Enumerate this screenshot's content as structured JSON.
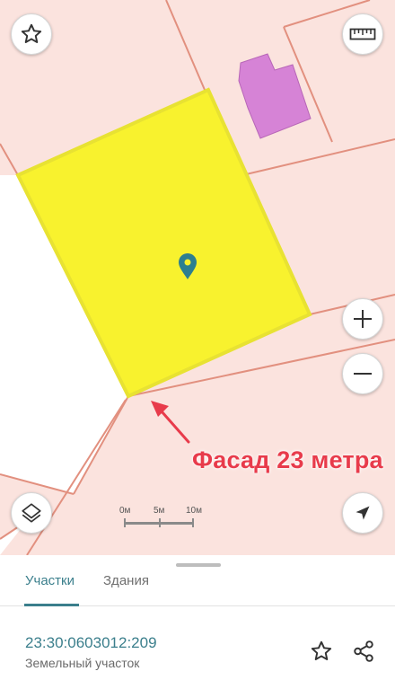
{
  "map": {
    "annotation": "Фасад 23 метра",
    "scale_labels": [
      "0м",
      "5м",
      "10м"
    ],
    "colors": {
      "land": "#fbe3de",
      "parcel_border": "#e2907f",
      "selected_fill": "#f8f22e",
      "selected_border": "#e8e232",
      "building": "#d683d6",
      "annotation": "#e83b4b",
      "marker": "#2d7f8f"
    },
    "controls": {
      "favorite": "star-icon",
      "ruler": "ruler-icon",
      "zoom_in": "plus-icon",
      "zoom_out": "minus-icon",
      "layers": "layers-icon",
      "locate": "navigation-arrow-icon"
    }
  },
  "panel": {
    "tabs": [
      {
        "label": "Участки",
        "active": true
      },
      {
        "label": "Здания",
        "active": false
      }
    ],
    "parcel": {
      "cadastral_number": "23:30:0603012:209",
      "type": "Земельный участок"
    },
    "accent": "#3b7f8c"
  }
}
